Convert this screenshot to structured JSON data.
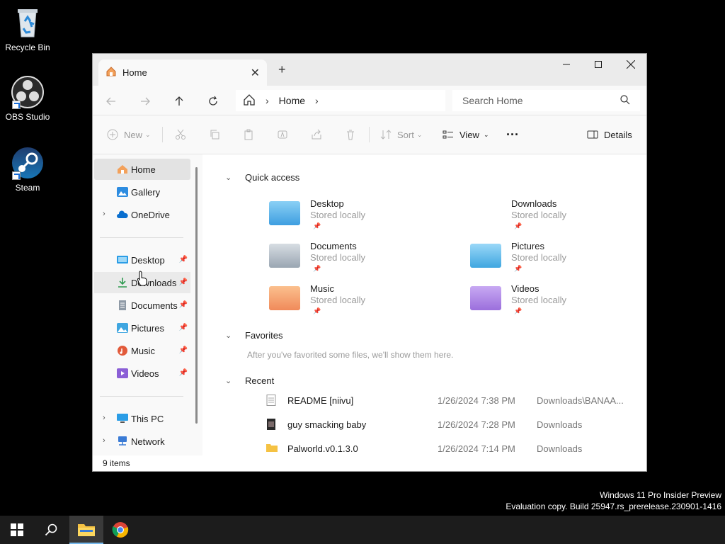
{
  "desktop": {
    "icons": [
      {
        "label": "Recycle Bin",
        "icon": "recycle-bin-icon"
      },
      {
        "label": "OBS Studio",
        "icon": "obs-icon"
      },
      {
        "label": "Steam",
        "icon": "steam-icon"
      }
    ],
    "watermark": {
      "line1": "Windows 11 Pro Insider Preview",
      "line2": "Evaluation copy. Build 25947.rs_prerelease.230901-1416"
    }
  },
  "window": {
    "tab_title": "Home",
    "new_tab": "+",
    "address": {
      "crumb": "Home"
    },
    "search_placeholder": "Search Home",
    "toolbar": {
      "new_label": "New",
      "sort_label": "Sort",
      "view_label": "View",
      "more_label": "···",
      "details_label": "Details"
    },
    "sidebar": {
      "top": [
        "Home",
        "Gallery",
        "OneDrive"
      ],
      "pinned": [
        "Desktop",
        "Downloads",
        "Documents",
        "Pictures",
        "Music",
        "Videos"
      ],
      "bottom": [
        "This PC",
        "Network"
      ]
    },
    "main": {
      "quick_access_label": "Quick access",
      "quick_access": [
        {
          "name": "Desktop",
          "sub": "Stored locally",
          "color": "#4aa3df"
        },
        {
          "name": "Downloads",
          "sub": "Stored locally",
          "color": "#3aa657"
        },
        {
          "name": "Documents",
          "sub": "Stored locally",
          "color": "#9aa6b2"
        },
        {
          "name": "Pictures",
          "sub": "Stored locally",
          "color": "#3fa6e0"
        },
        {
          "name": "Music",
          "sub": "Stored locally",
          "color": "#f08a5a"
        },
        {
          "name": "Videos",
          "sub": "Stored locally",
          "color": "#9b6fdc"
        }
      ],
      "favorites_label": "Favorites",
      "favorites_empty": "After you've favorited some files, we'll show them here.",
      "recent_label": "Recent",
      "recent": [
        {
          "name": "README [niivu]",
          "date": "1/26/2024 7:38 PM",
          "location": "Downloads\\BANAA..."
        },
        {
          "name": "guy smacking baby",
          "date": "1/26/2024 7:28 PM",
          "location": "Downloads"
        },
        {
          "name": "Palworld.v0.1.3.0",
          "date": "1/26/2024 7:14 PM",
          "location": "Downloads"
        }
      ]
    },
    "status": "9 items"
  }
}
